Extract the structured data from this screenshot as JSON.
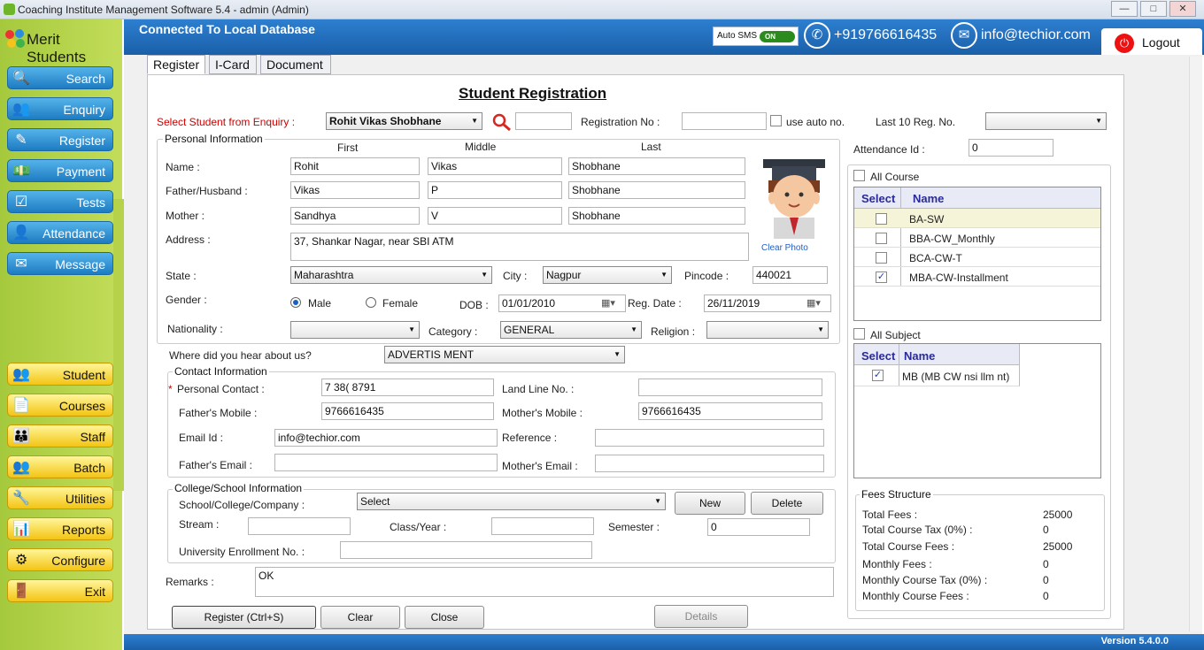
{
  "window": {
    "title": "Coaching Institute Management Software 5.4  -  admin (Admin)"
  },
  "brand": "Merit Students",
  "nav_top": [
    "Search",
    "Enquiry",
    "Register",
    "Payment",
    "Tests",
    "Attendance",
    "Message"
  ],
  "nav_bottom": [
    "Student",
    "Courses",
    "Staff",
    "Batch",
    "Utilities",
    "Reports",
    "Configure",
    "Exit"
  ],
  "topbar": {
    "connection": "Connected To  Local Database",
    "auto_sms_label": "Auto SMS",
    "auto_sms_state": "ON",
    "phone": "+919766616435",
    "email": "info@techior.com",
    "logout": "Logout"
  },
  "tabs": [
    "Register",
    "I-Card",
    "Document"
  ],
  "form": {
    "title": "Student Registration",
    "enquiry_label": "Select Student from Enquiry :",
    "enquiry_value": "Rohit Vikas Shobhane",
    "reg_no_label": "Registration No :",
    "use_auto_label": "use auto no.",
    "last10_label": "Last 10 Reg. No.",
    "attendance_label": "Attendance Id  :",
    "attendance_value": "0",
    "personal_group": "Personal Information",
    "col_first": "First",
    "col_middle": "Middle",
    "col_last": "Last",
    "name_label": "Name :",
    "name": [
      "Rohit",
      "Vikas",
      "Shobhane"
    ],
    "father_label": "Father/Husband :",
    "father": [
      "Vikas",
      "P",
      "Shobhane"
    ],
    "mother_label": "Mother :",
    "mother": [
      "Sandhya",
      "V",
      "Shobhane"
    ],
    "address_label": "Address :",
    "address": "37, Shankar Nagar, near SBI ATM",
    "clear_photo": "Clear Photo",
    "state_label": "State :",
    "state": "Maharashtra",
    "city_label": "City :",
    "city": "Nagpur",
    "pincode_label": "Pincode :",
    "pincode": "440021",
    "gender_label": "Gender :",
    "male": "Male",
    "female": "Female",
    "dob_label": "DOB :",
    "dob": "01/01/2010",
    "regdate_label": "Reg. Date :",
    "regdate": "26/11/2019",
    "nationality_label": "Nationality :",
    "category_label": "Category :",
    "category": "GENERAL",
    "religion_label": "Religion :",
    "hear_label": "Where did you hear about us?",
    "hear": "ADVERTIS   MENT",
    "contact_group": "Contact Information",
    "personal_contact_label": "Personal Contact :",
    "personal_contact": "7 38(  8791",
    "landline_label": "Land Line No. :",
    "father_mobile_label": "Father's Mobile :",
    "father_mobile": "9766616435",
    "mother_mobile_label": "Mother's Mobile :",
    "mother_mobile": "9766616435",
    "email_label": "Email Id :",
    "email": "info@techior.com",
    "reference_label": "Reference :",
    "father_email_label": "Father's Email :",
    "mother_email_label": "Mother's Email :",
    "college_group": "College/School Information",
    "school_label": "School/College/Company :",
    "school": "Select",
    "new_btn": "New",
    "delete_btn": "Delete",
    "stream_label": "Stream :",
    "class_label": "Class/Year :",
    "semester_label": "Semester :",
    "semester": "0",
    "univ_label": "University Enrollment No. :",
    "remarks_label": "Remarks :",
    "remarks": "OK"
  },
  "buttons": {
    "register": "Register (Ctrl+S)",
    "clear": "Clear",
    "close": "Close",
    "details": "Details"
  },
  "courses": {
    "all_label": "All Course",
    "head_select": "Select",
    "head_name": "Name",
    "rows": [
      {
        "name": "BA-SW",
        "checked": false
      },
      {
        "name": "BBA-CW_Monthly",
        "checked": false
      },
      {
        "name": "BCA-CW-T",
        "checked": false
      },
      {
        "name": "MBA-CW-Installment",
        "checked": true
      }
    ]
  },
  "subjects": {
    "all_label": "All Subject",
    "head_select": "Select",
    "head_name": "Name",
    "rows": [
      {
        "name": "MB  (MB  CW  nsi  llm  nt)",
        "checked": true
      }
    ]
  },
  "fees": {
    "title": "Fees Structure",
    "rows": [
      {
        "label": "Total Fees :",
        "value": "25000"
      },
      {
        "label": "Total Course Tax (0%) :",
        "value": "0"
      },
      {
        "label": "Total Course Fees :",
        "value": "25000"
      },
      {
        "label": "Monthly Fees :",
        "value": "0"
      },
      {
        "label": "Monthly Course Tax (0%) :",
        "value": "0"
      },
      {
        "label": "Monthly Course Fees :",
        "value": "0"
      }
    ]
  },
  "version": "Version 5.4.0.0",
  "colors": {
    "nav_blue": "#1d7bc2",
    "nav_yellow": "#f3c414",
    "sidebar_green": "#a5c93c",
    "topbar_blue": "#2d7fd1"
  }
}
